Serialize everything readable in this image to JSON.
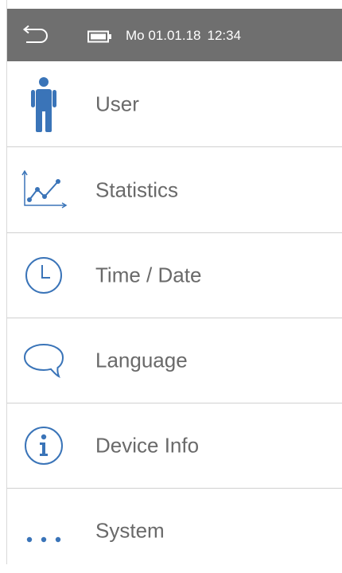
{
  "status_bar": {
    "date": "Mo 01.01.18",
    "time": "12:34",
    "back_icon": "back-arrow-icon",
    "battery_icon": "battery-icon",
    "background": "#6f6f6f",
    "text_color": "#ffffff"
  },
  "menu": {
    "accent_color": "#3a74b8",
    "label_color": "#6a6a6a",
    "items": [
      {
        "label": "User",
        "icon": "person-icon"
      },
      {
        "label": "Statistics",
        "icon": "line-chart-icon"
      },
      {
        "label": "Time / Date",
        "icon": "clock-icon"
      },
      {
        "label": "Language",
        "icon": "speech-bubble-icon"
      },
      {
        "label": "Device Info",
        "icon": "info-icon"
      },
      {
        "label": "System",
        "icon": "ellipsis-icon"
      }
    ]
  }
}
